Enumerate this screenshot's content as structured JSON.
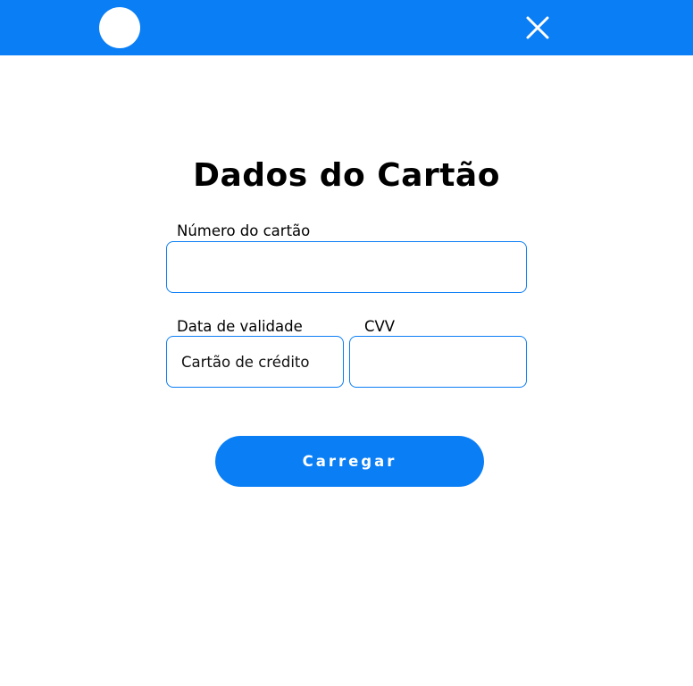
{
  "header": {
    "avatar_icon": "avatar-circle",
    "close_icon": "close-x-icon"
  },
  "form": {
    "title": "Dados do Cartão",
    "card_number": {
      "label": "Número do cartão",
      "value": "",
      "placeholder": ""
    },
    "expiry": {
      "label": "Data de validade",
      "value": "",
      "placeholder": "Cartão de crédito"
    },
    "cvv": {
      "label": "CVV",
      "value": "",
      "placeholder": ""
    },
    "submit_label": "Carregar"
  },
  "colors": {
    "accent": "#0a7ef5",
    "background": "#ffffff",
    "text": "#000000"
  }
}
